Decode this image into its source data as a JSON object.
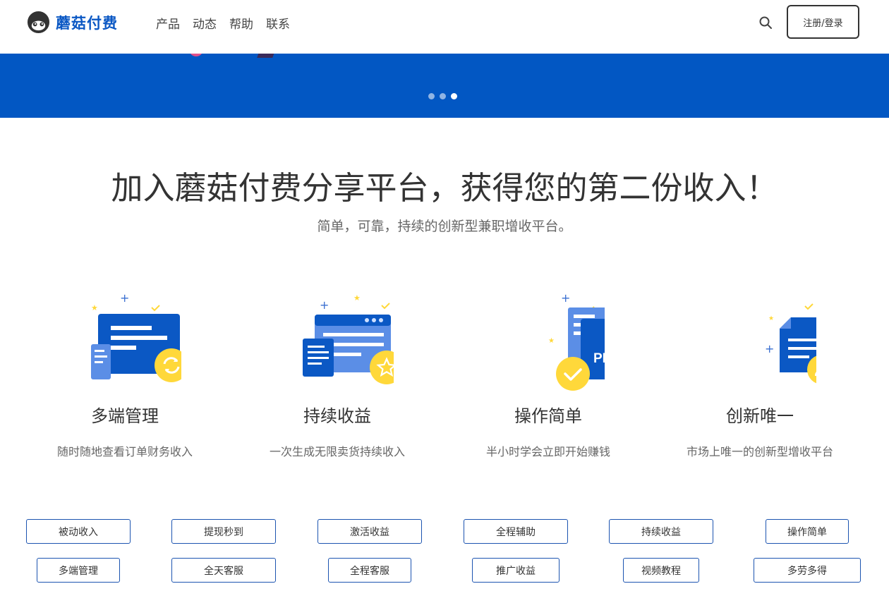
{
  "header": {
    "logo_text": "蘑菇付费",
    "nav": [
      "产品",
      "动态",
      "帮助",
      "联系"
    ],
    "login_label": "注册/登录"
  },
  "banner": {
    "slide_count": 3,
    "active_slide": 3
  },
  "hero": {
    "headline": "加入蘑菇付费分享平台，获得您的第二份收入！",
    "subline": "简单，可靠，持续的创新型兼职增收平台。"
  },
  "features": [
    {
      "title": "多端管理",
      "desc": "随时随地查看订单财务收入",
      "icon": "multi-device-sync-icon"
    },
    {
      "title": "持续收益",
      "desc": "一次生成无限卖货持续收入",
      "icon": "window-star-icon"
    },
    {
      "title": "操作简单",
      "desc": "半小时学会立即开始赚钱",
      "icon": "pdf-check-icon",
      "icon_text": "PDF"
    },
    {
      "title": "创新唯一",
      "desc": "市场上唯一的创新型增收平台",
      "icon": "document-user-icon"
    }
  ],
  "tags": [
    [
      "被动收入",
      "提现秒到",
      "激活收益",
      "全程辅助",
      "持续收益",
      "操作简单"
    ],
    [
      "多端管理",
      "全天客服",
      "全程客服",
      "推广收益",
      "视频教程",
      "多劳多得"
    ]
  ],
  "colors": {
    "brand_blue": "#0b58c4",
    "banner_blue": "#0257c3",
    "accent_yellow": "#ffd83a",
    "tag_border": "#1c54b0"
  }
}
